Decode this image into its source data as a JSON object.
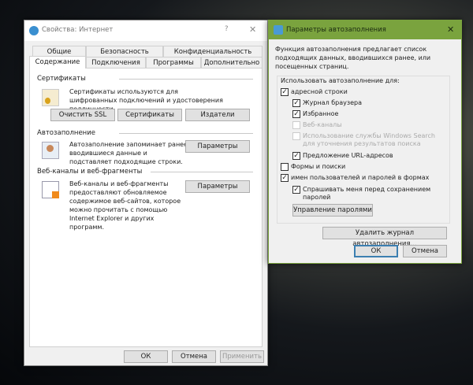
{
  "internet_options": {
    "title": "Свойства: Интернет",
    "help": "?",
    "close": "✕",
    "tabs_row1": [
      "Общие",
      "Безопасность",
      "Конфиденциальность"
    ],
    "tabs_row2": [
      "Содержание",
      "Подключения",
      "Программы",
      "Дополнительно"
    ],
    "certificates": {
      "heading": "Сертификаты",
      "desc": "Сертификаты используются для шифрованных подключений и удостоверения подлинности.",
      "buttons": [
        "Очистить SSL",
        "Сертификаты",
        "Издатели"
      ]
    },
    "autocomplete": {
      "heading": "Автозаполнение",
      "desc": "Автозаполнение запоминает ранее вводившиеся данные и подставляет подходящие строки.",
      "button": "Параметры"
    },
    "feeds": {
      "heading": "Веб-каналы и веб-фрагменты",
      "desc": "Веб-каналы и веб-фрагменты предоставляют обновляемое содержимое веб-сайтов, которое можно прочитать с помощью Internet Explorer и других программ.",
      "button": "Параметры"
    },
    "footer": {
      "ok": "ОК",
      "cancel": "Отмена",
      "apply": "Применить"
    }
  },
  "autocomplete_settings": {
    "title": "Параметры автозаполнения",
    "close": "✕",
    "accent": "#7aa33e",
    "intro": "Функция автозаполнения предлагает список подходящих данных, вводившихся ранее, или посещенных страниц.",
    "group_label": "Использовать автозаполнение для:",
    "options": [
      {
        "label": "адресной строки",
        "checked": true
      },
      {
        "label": "Журнал браузера",
        "checked": true
      },
      {
        "label": "Избранное",
        "checked": true
      },
      {
        "label": "Веб-каналы",
        "checked": false,
        "disabled": true
      },
      {
        "label": "Использование службы Windows Search для уточнения результатов поиска",
        "checked": false,
        "disabled": true
      },
      {
        "label": "Предложение URL-адресов",
        "checked": true
      },
      {
        "label": "Формы и поиски",
        "checked": false
      },
      {
        "label": "имен пользователей и паролей в формах",
        "checked": true
      },
      {
        "label": "Спрашивать меня перед сохранением паролей",
        "checked": true
      }
    ],
    "manage_passwords": "Управление паролями",
    "delete_history": "Удалить журнал автозаполнения...",
    "ok": "ОК",
    "cancel": "Отмена"
  }
}
